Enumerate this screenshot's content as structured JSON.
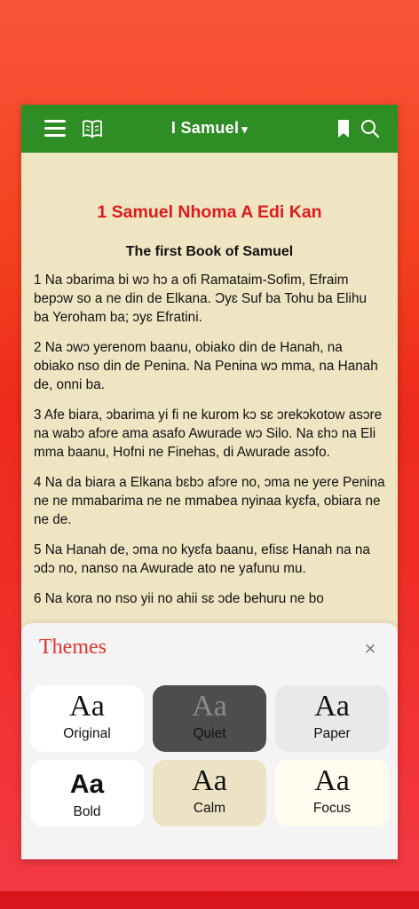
{
  "toolbar": {
    "book_title": "I Samuel",
    "caret": "▾"
  },
  "reader": {
    "heading": "1 Samuel Nhoma A Edi Kan",
    "subtitle": "The first Book of Samuel",
    "verses": [
      "1 Na ɔbarima bi wɔ hɔ a ofi Ramataim-Sofim, Efraim bepɔw so a ne din de Elkana. Ɔyɛ Suf ba Tohu ba Elihu ba Yeroham ba; ɔyɛ Efratini.",
      "2 Na ɔwɔ yerenom baanu, obiako din de Hanah, na obiako nso din de Penina. Na Penina wɔ mma, na Hanah de, onni ba.",
      "3 Afe biara, ɔbarima yi fi ne kurom kɔ sɛ ɔrekɔkotow asɔre na wabɔ afɔre ama asafo Awurade wɔ Silo. Na ɛhɔ na Eli mma baanu, Hofni ne Finehas, di Awurade asɔfo.",
      "4 Na da biara a Elkana bɛbɔ afɔre no, ɔma ne yere Penina ne ne mmabarima ne ne mmabea nyinaa kyɛfa, obiara ne ne de.",
      "5 Na Hanah de, ɔma no kyɛfa baanu, efisɛ Hanah na na ɔdɔ no, nanso na Awurade ato ne yafunu mu.",
      "6 Na kora no nso yii no ahii sɛ ɔde behuru ne bo"
    ]
  },
  "themes": {
    "title": "Themes",
    "close": "×",
    "sample": "Aa",
    "options": [
      {
        "name": "Original",
        "color": "#ffffff"
      },
      {
        "name": "Quiet",
        "color": "#4d4d4d"
      },
      {
        "name": "Paper",
        "color": "#eae8ea"
      },
      {
        "name": "Bold",
        "color": "#ffffff"
      },
      {
        "name": "Calm",
        "color": "#ede3c4"
      },
      {
        "name": "Focus",
        "color": "#fffbef"
      }
    ]
  },
  "colors": {
    "toolbar": "#2f8d25",
    "accent_red": "#e0191c",
    "page": "#efe5c3"
  },
  "icons": [
    "hamburger-menu-icon",
    "open-book-icon",
    "bookmark-icon",
    "search-icon",
    "close-icon"
  ]
}
